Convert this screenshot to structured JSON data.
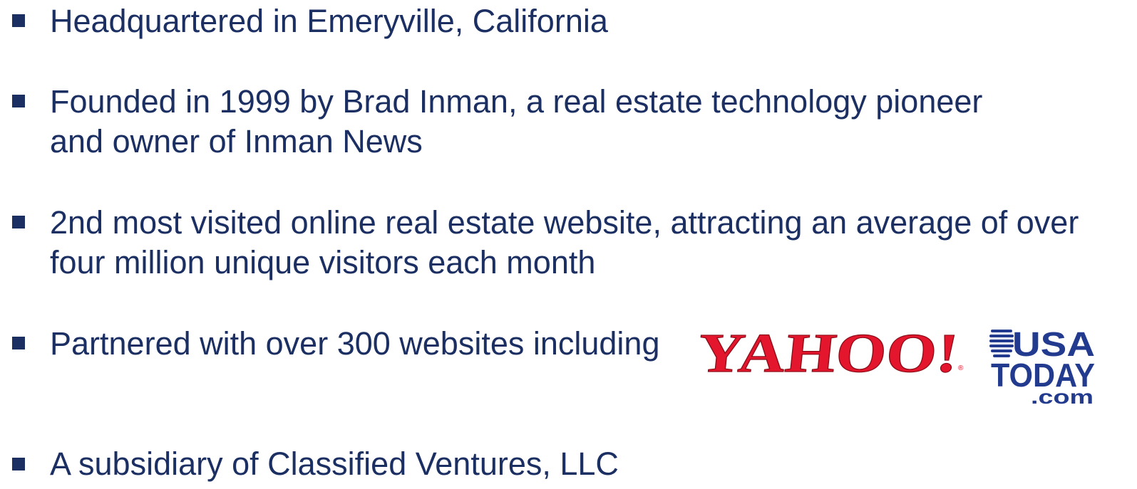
{
  "bullets": [
    {
      "lines": [
        "Headquartered in Emeryville, California"
      ]
    },
    {
      "lines": [
        "Founded in 1999 by Brad Inman, a real estate technology pioneer",
        "and owner of Inman News"
      ]
    },
    {
      "lines": [
        "2nd most visited online real estate website, attracting an average of over",
        "four million unique visitors each month"
      ]
    },
    {
      "lines": [
        "Partnered with over 300 websites including"
      ]
    },
    {
      "lines": [
        "A subsidiary of Classified Ventures, LLC"
      ]
    }
  ],
  "logos": {
    "yahoo": {
      "text": "YAHOO!",
      "mark": "®",
      "color": "#e3162d"
    },
    "usa_today": {
      "line1": "USA",
      "line2": "TODAY",
      "line3": ".com",
      "color": "#233b8f"
    }
  },
  "colors": {
    "text": "#1b2f63",
    "bullet": "#1b2f63"
  }
}
